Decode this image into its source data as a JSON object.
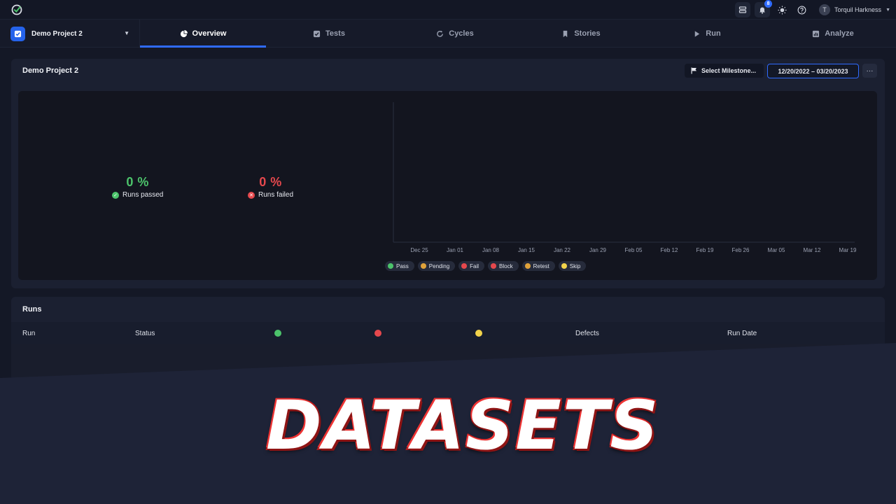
{
  "topbar": {
    "notification_count": "8",
    "user_initial": "T",
    "user_name": "Torquil Harkness"
  },
  "navbar": {
    "project_name": "Demo Project 2",
    "tabs": [
      {
        "label": "Overview",
        "icon": "pie-chart-icon",
        "active": true
      },
      {
        "label": "Tests",
        "icon": "checkbox-icon",
        "active": false
      },
      {
        "label": "Cycles",
        "icon": "refresh-icon",
        "active": false
      },
      {
        "label": "Stories",
        "icon": "bookmark-icon",
        "active": false
      },
      {
        "label": "Run",
        "icon": "play-icon",
        "active": false
      },
      {
        "label": "Analyze",
        "icon": "bar-chart-icon",
        "active": false
      }
    ]
  },
  "overview": {
    "title": "Demo Project 2",
    "milestone_label": "Select Milestone...",
    "date_range": "12/20/2022  –  03/20/2023",
    "more_label": "···",
    "passed": {
      "value": "0 %",
      "label": "Runs passed",
      "color": "#4cc36b"
    },
    "failed": {
      "value": "0 %",
      "label": "Runs failed",
      "color": "#e5484d"
    }
  },
  "chart_data": {
    "type": "line",
    "x": [
      "Dec 25",
      "Jan 01",
      "Jan 08",
      "Jan 15",
      "Jan 22",
      "Jan 29",
      "Feb 05",
      "Feb 12",
      "Feb 19",
      "Feb 26",
      "Mar 05",
      "Mar 12",
      "Mar 19"
    ],
    "series": [],
    "legend": [
      {
        "name": "Pass",
        "color": "#4cc36b"
      },
      {
        "name": "Pending",
        "color": "#e0a23a"
      },
      {
        "name": "Fail",
        "color": "#e5484d"
      },
      {
        "name": "Block",
        "color": "#e5484d"
      },
      {
        "name": "Retest",
        "color": "#e0a23a"
      },
      {
        "name": "Skip",
        "color": "#f2d34b"
      }
    ],
    "legend_position": "bottom",
    "grid": false
  },
  "runs": {
    "title": "Runs",
    "columns": {
      "run": "Run",
      "status": "Status",
      "defects": "Defects",
      "run_date": "Run Date"
    }
  },
  "banner": {
    "text": "DATASETS"
  }
}
